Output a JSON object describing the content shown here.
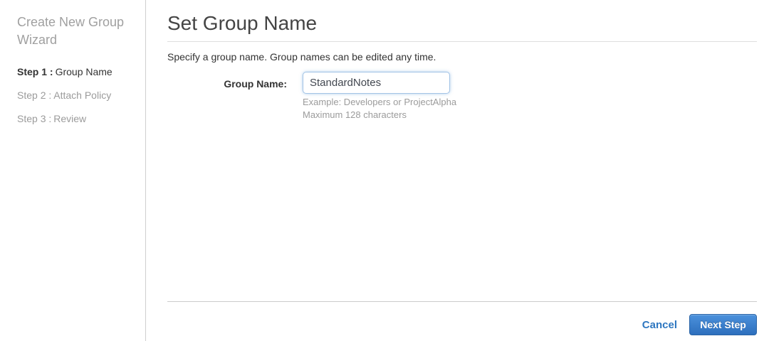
{
  "sidebar": {
    "title": "Create New Group Wizard",
    "steps": [
      {
        "prefix": "Step 1 :",
        "label": "Group Name",
        "active": true
      },
      {
        "prefix": "Step 2 :",
        "label": "Attach Policy",
        "active": false
      },
      {
        "prefix": "Step 3 :",
        "label": "Review",
        "active": false
      }
    ]
  },
  "main": {
    "title": "Set Group Name",
    "description": "Specify a group name. Group names can be edited any time.",
    "form": {
      "group_name_label": "Group Name:",
      "group_name_value": "StandardNotes",
      "hint_example": "Example: Developers or ProjectAlpha",
      "hint_max": "Maximum 128 characters"
    },
    "footer": {
      "cancel_label": "Cancel",
      "next_label": "Next Step"
    }
  },
  "colors": {
    "link_blue": "#2e77c0",
    "button_gradient_top": "#4b91dc",
    "button_gradient_bottom": "#2d6fbd",
    "input_focus_border": "#a3c4e6",
    "inactive_gray": "#9b9b9b"
  }
}
